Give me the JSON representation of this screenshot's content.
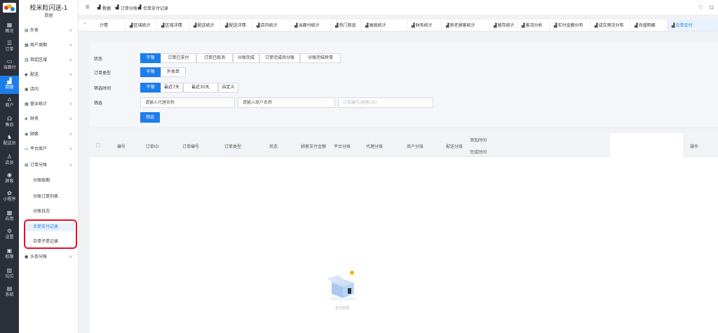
{
  "app": {
    "title": "校米粒闪送-1",
    "subtitle": "数据"
  },
  "rail": [
    {
      "label": "概况",
      "icon": "dashboard-icon"
    },
    {
      "label": "订单",
      "icon": "order-icon"
    },
    {
      "label": "当面付",
      "icon": "pay-icon"
    },
    {
      "label": "数据",
      "icon": "chart-icon",
      "active": true
    },
    {
      "label": "商户",
      "icon": "store-icon"
    },
    {
      "label": "售后",
      "icon": "headset-icon"
    },
    {
      "label": "配送员",
      "icon": "courier-icon"
    },
    {
      "label": "店员",
      "icon": "staff-icon"
    },
    {
      "label": "顾客",
      "icon": "customer-icon"
    },
    {
      "label": "小程序",
      "icon": "miniapp-icon"
    },
    {
      "label": "应用",
      "icon": "apps-icon"
    },
    {
      "label": "设置",
      "icon": "settings-icon"
    },
    {
      "label": "权限",
      "icon": "lock-icon"
    },
    {
      "label": "坑位",
      "icon": "slot-icon"
    },
    {
      "label": "系统",
      "icon": "system-icon"
    }
  ],
  "sidebar": {
    "items": [
      {
        "label": "外卖",
        "icon": "takeout-icon",
        "chevron": "∨"
      },
      {
        "label": "商户周期",
        "icon": "store-cycle-icon",
        "chevron": "∨"
      },
      {
        "label": "指定区域",
        "icon": "region-icon",
        "chevron": "∨"
      },
      {
        "label": "配送",
        "icon": "delivery-icon",
        "chevron": "∨"
      },
      {
        "label": "店内",
        "icon": "instore-icon",
        "chevron": "∨"
      },
      {
        "label": "营业统计",
        "icon": "business-icon",
        "chevron": "∨"
      },
      {
        "label": "财务",
        "icon": "finance-icon",
        "chevron": "∨"
      },
      {
        "label": "顾客",
        "icon": "customer-icon",
        "chevron": "∨"
      },
      {
        "label": "平台商户",
        "icon": "merchant-icon",
        "chevron": "∨"
      },
      {
        "label": "订单分账",
        "icon": "split-icon",
        "chevron": "∧"
      }
    ],
    "children": [
      "分账账期",
      "分账订单列表",
      "分账日志",
      "合单支付记录",
      "合单子单记录"
    ],
    "last": {
      "label": "头条分账",
      "icon": "toutiao-icon",
      "chevron": "∨"
    }
  },
  "topbar": {
    "breadcrumb": [
      "数据",
      "订单分账",
      "合单支付记录"
    ],
    "sep": ">",
    "menu_icon": "☰",
    "right_icons": [
      "⛶",
      "□"
    ]
  },
  "tabs": {
    "prev": "‹",
    "items": [
      "计情",
      "区域统计",
      "区域详情",
      "配送统计",
      "配送详情",
      "店内统计",
      "当面付统计",
      "热门商品",
      "高级统计",
      "财务统计",
      "新老顾客统计",
      "留存统计",
      "客流分析",
      "实付金额分布",
      "成交频次分布",
      "充值明细",
      "合单支付"
    ]
  },
  "filters": {
    "status": {
      "label": "状态",
      "options": [
        "不限",
        "订单已支付",
        "订单已取消",
        "分账完成",
        "订单完成待分账",
        "分账完结异常"
      ]
    },
    "order_type": {
      "label": "订单类型",
      "options": [
        "不限",
        "外卖单"
      ]
    },
    "time": {
      "label": "筛选时间",
      "options": [
        "不限",
        "最近7天",
        "最近30天",
        "自定义"
      ]
    },
    "filter": {
      "label": "筛选",
      "agent": "请输入代理名称",
      "merchant": "请输入商户名称",
      "order_placeholder": "订单编号/顾客UID"
    },
    "submit": "筛选"
  },
  "table": {
    "headers": [
      "编号",
      "订单ID",
      "订单编号",
      "订单类型",
      "状态",
      "顾客支付金额",
      "平台分账",
      "代理分账",
      "商户分账",
      "配送分账",
      "添加时间",
      "完成时间",
      "操作"
    ],
    "empty": "暂无数据"
  }
}
